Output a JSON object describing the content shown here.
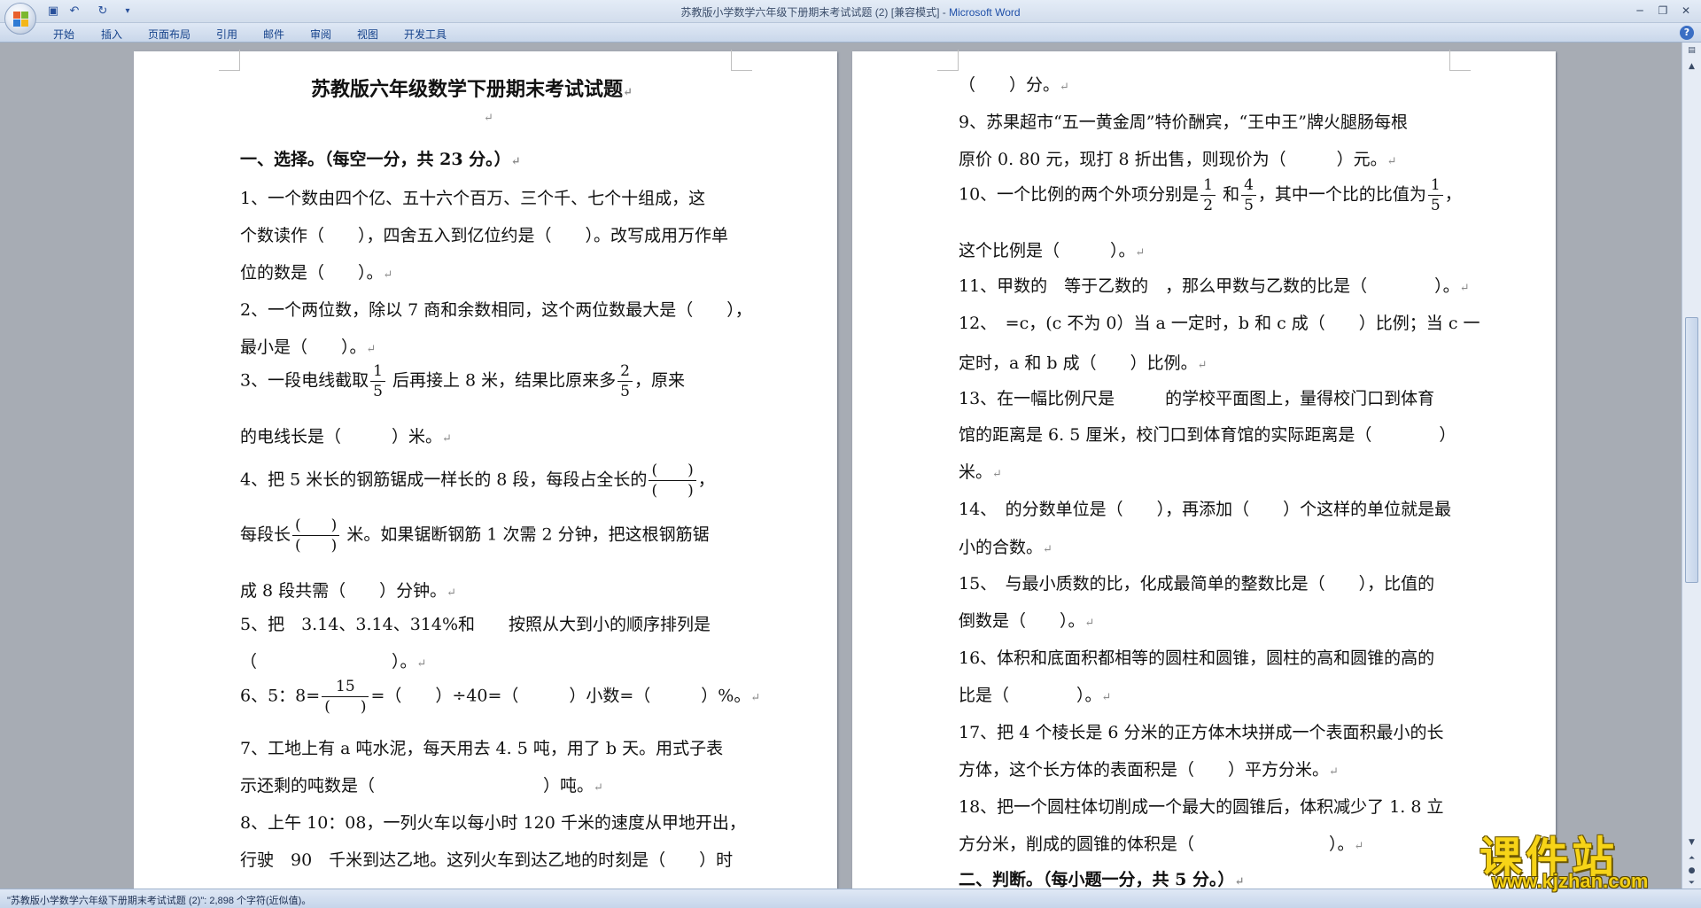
{
  "window": {
    "title_doc": "苏教版小学数学六年级下册期末考试试题 (2) [兼容模式] - ",
    "title_app": "Microsoft Word",
    "qat_save_icon": "save-icon",
    "qat_undo_icon": "undo-icon",
    "qat_redo_icon": "redo-icon",
    "qat_more": "▾",
    "help": "?"
  },
  "ribbon": {
    "tabs": [
      "开始",
      "插入",
      "页面布局",
      "引用",
      "邮件",
      "审阅",
      "视图",
      "开发工具"
    ]
  },
  "left_page": {
    "title": "苏教版六年级数学下册期末考试试题",
    "section1": "一、选择。（每空一分，共 23 分。）",
    "q1_a": "1、一个数由四个亿、五十六个百万、三个千、七个十组成，这",
    "q1_b": "个数读作（　　），四舍五入到亿位约是（　　）。改写成用万作单",
    "q1_c": "位的数是（　　）。",
    "q2_a": "2、一个两位数，除以 7 商和余数相同，这个两位数最大是（　　），",
    "q2_b": "最小是（　　）。",
    "q3_pre": "3、一段电线截取",
    "q3_f1_num": "1",
    "q3_f1_den": "5",
    "q3_mid": "后再接上 8 米，结果比原来多",
    "q3_f2_num": "2",
    "q3_f2_den": "5",
    "q3_post": "，原来",
    "q3_b": "的电线长是（　　　）米。",
    "q4_pre": "4、把 5 米长的钢筋锯成一样长的 8 段，每段占全长的",
    "q4_blank_frac_num": "(　　)",
    "q4_blank_frac_den": "(　　)",
    "q4_post": "，",
    "q4_b_pre": "每段长",
    "q4_b_post": "米。如果锯断钢筋 1 次需 2 分钟，把这根钢筋锯",
    "q4_c": "成 8 段共需（　　）分钟。",
    "q5_a": "5、把　3.14、3.14、314%和　　按照从大到小的顺序排列是",
    "q5_b": "（　　　　　　　　）。",
    "q6_pre": "6、5：8=",
    "q6_frac_num": "15",
    "q6_frac_den": "(　　)",
    "q6_post": "=（　　）÷40=（　　　）小数=（　　　）%。",
    "q7_a": "7、工地上有 a 吨水泥，每天用去 4. 5 吨，用了 b 天。用式子表",
    "q7_b": "示还剩的吨数是（　　　　　　　　　　）吨。",
    "q8_a": "8、上午 10：08，一列火车以每小时 120 千米的速度从甲地开出，",
    "q8_b": "行驶　90　千米到达乙地。这列火车到达乙地的时刻是（　　）时"
  },
  "right_page": {
    "r0": "（　　）分。",
    "q9_a": "9、苏果超市“五一黄金周”特价酬宾，“王中王”牌火腿肠每根",
    "q9_b": "原价 0. 80 元，现打 8 折出售，则现价为（　　　）元。",
    "q10_pre": "10、一个比例的两个外项分别是",
    "q10_f1_num": "1",
    "q10_f1_den": "2",
    "q10_and": "和",
    "q10_f2_num": "4",
    "q10_f2_den": "5",
    "q10_mid": "，其中一个比的比值为",
    "q10_f3_num": "1",
    "q10_f3_den": "5",
    "q10_post": "，",
    "q10_b": "这个比例是（　　　）。",
    "q11": "11、甲数的　等于乙数的　，那么甲数与乙数的比是（　　　　）。",
    "q12_a": "12、　=c，(c 不为 0）当 a 一定时，b 和 c 成（　　）比例；当 c 一",
    "q12_b": "定时，a 和 b 成（　　）比例。",
    "q13_a": "13、在一幅比例尺是　　　的学校平面图上，量得校门口到体育",
    "q13_b": "馆的距离是 6. 5 厘米，校门口到体育馆的实际距离是（　　　　）",
    "q13_c": "米。",
    "q14_a": "14、　的分数单位是（　　），再添加（　　）个这样的单位就是最",
    "q14_b": "小的合数。",
    "q15_a": "15、　与最小质数的比，化成最简单的整数比是（　　），比值的",
    "q15_b": "倒数是（　　）。",
    "q16_a": "16、体积和底面积都相等的圆柱和圆锥，圆柱的高和圆锥的高的",
    "q16_b": "比是（　　　　）。",
    "q17_a": "17、把 4 个棱长是 6 分米的正方体木块拼成一个表面积最小的长",
    "q17_b": "方体，这个长方体的表面积是（　　）平方分米。",
    "q18_a": "18、把一个圆柱体切削成一个最大的圆锥后，体积减少了 1. 8 立",
    "q18_b": "方分米，削成的圆锥的体积是（　　　　　　　　）。",
    "section2": "二、判断。（每小题一分，共 5 分。）"
  },
  "paragraph_mark": "↵",
  "statusbar": {
    "text": "\"苏教版小学数学六年级下册期末考试试题 (2)\": 2,898 个字符(近似值)。"
  },
  "watermark": {
    "chars": "课件站",
    "url": "www.kjzhan.com"
  }
}
